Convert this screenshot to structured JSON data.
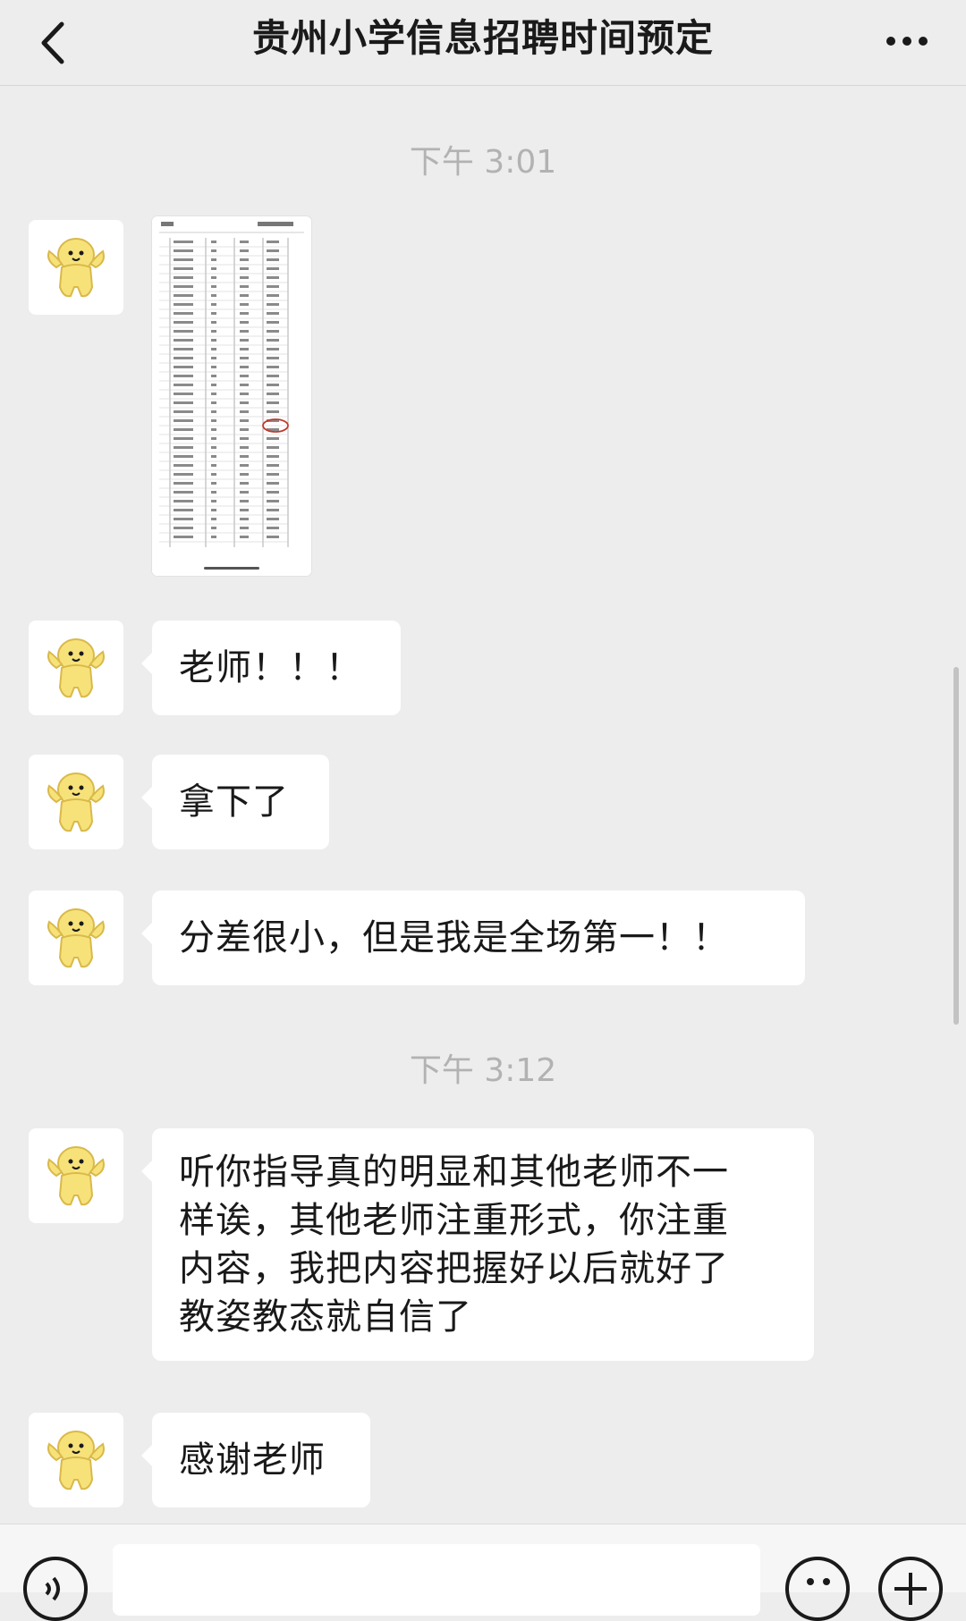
{
  "header": {
    "title": "贵州小学信息招聘时间预定",
    "back_icon": "chevron-left-icon",
    "more_icon": "more-dots-icon"
  },
  "messages": {
    "time1": "下午 3:01",
    "msg1": "老师！！！",
    "msg2": "拿下了",
    "msg3": "分差很小，但是我是全场第一！！",
    "time2": "下午 3:12",
    "msg4_lines": [
      "听你指导真的明显和其他老师不一",
      "样诶，其他老师注重形式，你注重",
      "内容，我把内容把握好以后就好了",
      "教姿教态就自信了"
    ],
    "msg5": "感谢老师"
  },
  "input_bar": {
    "voice_icon": "voice-icon",
    "emoji_icon": "emoji-icon",
    "plus_icon": "plus-icon"
  },
  "colors": {
    "background": "#ededed",
    "bubble": "#ffffff",
    "timestamp": "#b2b2b2",
    "avatar_yellow": "#f7e27a"
  }
}
